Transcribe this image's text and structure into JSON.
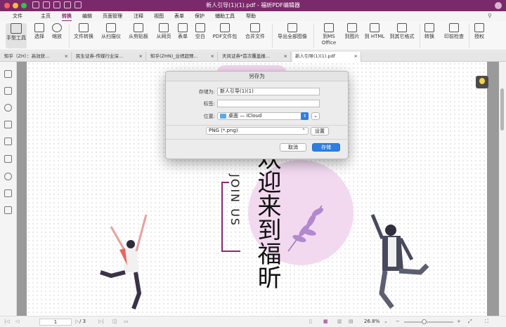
{
  "window": {
    "title": "新人引导(1)(1).pdf - 福昕PDF编辑器"
  },
  "menu": [
    "文件",
    "主页",
    "转换",
    "编辑",
    "页面管理",
    "注释",
    "视图",
    "表单",
    "保护",
    "辅助工具",
    "帮助"
  ],
  "ribbon": {
    "buttons": [
      "手型工具",
      "选择",
      "缩放",
      "文件转换",
      "从扫描仪",
      "从剪贴板",
      "从网页",
      "表单",
      "空白",
      "PDF文件包",
      "合并文件",
      "导出全部图像",
      "到MS Office",
      "到图片",
      "到 HTML",
      "到其它格式",
      "转换",
      "印前检查",
      "授权"
    ]
  },
  "tabs": [
    {
      "label": "知乎（ZH）：高效获...",
      "close": "×"
    },
    {
      "label": "民生证券-传媒行业深...",
      "close": "×"
    },
    {
      "label": "知乎(ZHN)_业绩超预...",
      "close": "×"
    },
    {
      "label": "天风证券*首次覆盖报...",
      "close": "×"
    },
    {
      "label": "新人引导(1)(1).pdf",
      "close": "×"
    }
  ],
  "dialog": {
    "title": "另存为",
    "save_as_label": "存储为:",
    "save_as_value": "新人引导(1)(1)",
    "tags_label": "标签:",
    "tags_value": "",
    "location_label": "位置:",
    "location_value": "桌面 — iCloud",
    "format_value": "PNG (*.png)",
    "settings_button": "设置",
    "cancel_button": "取消",
    "save_button": "存储"
  },
  "document": {
    "heading_cn": "欢迎来到福昕",
    "heading_en": "JOIN US"
  },
  "statusbar": {
    "page_current": "1",
    "page_total": "/ 3",
    "zoom": "26.8%"
  },
  "colors": {
    "brand": "#7a2a6a",
    "accent": "#8a2876",
    "primary_button": "#2f7de1"
  }
}
